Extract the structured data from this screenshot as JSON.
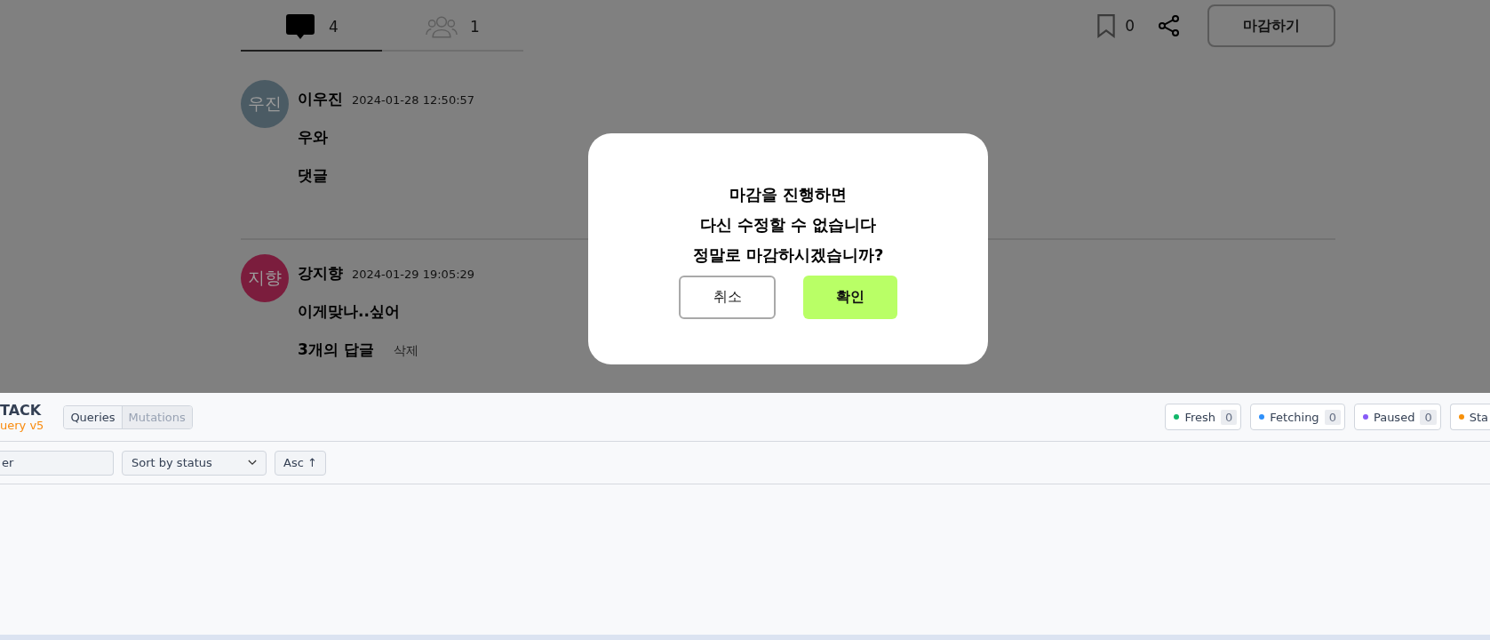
{
  "tabs": [
    {
      "kind": "comments",
      "count": "4",
      "selected": true
    },
    {
      "kind": "participants",
      "count": "1",
      "selected": false
    }
  ],
  "bookmark": {
    "count": "0"
  },
  "close_button": "마감하기",
  "comments": [
    {
      "avatar": "우진",
      "color": "#4b5b64",
      "name": "이우진",
      "time": "2024-01-28 12:50:57",
      "lines": [
        "우와",
        "댓글"
      ]
    },
    {
      "avatar": "지향",
      "color": "#7b1d3d",
      "name": "강지향",
      "time": "2024-01-29 19:05:29",
      "lines": [
        "이게맞나..싶어"
      ],
      "replies": "3개의 답글",
      "delete": "삭제"
    }
  ],
  "dialog": {
    "lines": [
      "마감을 진행하면",
      "다신 수정할 수 없습니다",
      "정말로 마감하시겠습니까?"
    ],
    "cancel": "취소",
    "confirm": "확인"
  },
  "devtools": {
    "logo_top": "TACK",
    "logo_bottom": "uery v5",
    "tabs": [
      {
        "label": "Queries",
        "selected": true
      },
      {
        "label": "Mutations",
        "selected": false
      }
    ],
    "statuses": [
      {
        "label": "Fresh",
        "count": "0",
        "color": "#12b76a"
      },
      {
        "label": "Fetching",
        "count": "0",
        "color": "#2e90fa"
      },
      {
        "label": "Paused",
        "count": "0",
        "color": "#875bf7"
      },
      {
        "label": "Sta",
        "color": "#f79009"
      }
    ],
    "filter": {
      "placeholder": "er"
    },
    "sort": "Sort by status",
    "order": "Asc ↑"
  }
}
